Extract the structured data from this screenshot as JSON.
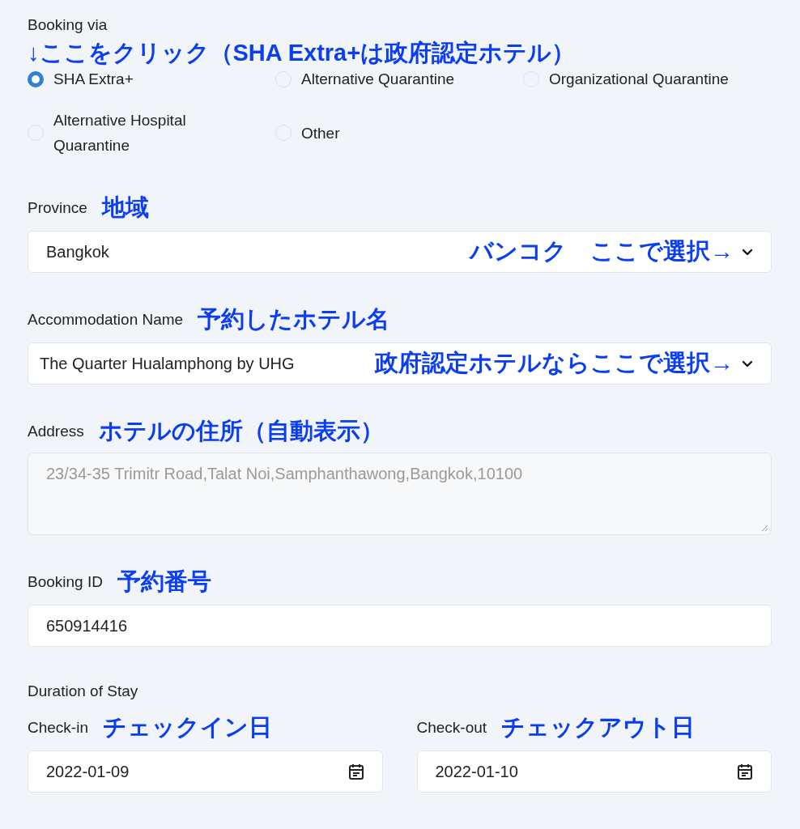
{
  "booking_via": {
    "label": "Booking via",
    "note": "↓ここをクリック（SHA Extra+は政府認定ホテル）",
    "options": [
      {
        "label": "SHA Extra+",
        "selected": true
      },
      {
        "label": "Alternative Quarantine",
        "selected": false
      },
      {
        "label": "Organizational Quarantine",
        "selected": false
      },
      {
        "label": "Alternative Hospital Quarantine",
        "selected": false
      },
      {
        "label": "Other",
        "selected": false
      }
    ]
  },
  "province": {
    "label": "Province",
    "note": "地域",
    "value": "Bangkok",
    "field_note": "バンコク　ここで選択→"
  },
  "accommodation": {
    "label": "Accommodation Name",
    "note": "予約したホテル名",
    "value": "The Quarter Hualamphong by UHG",
    "field_note": "政府認定ホテルならここで選択→"
  },
  "address": {
    "label": "Address",
    "note": "ホテルの住所（自動表示）",
    "value": "23/34-35 Trimitr Road,Talat Noi,Samphanthawong,Bangkok,10100",
    "disabled": true
  },
  "booking_id": {
    "label": "Booking ID",
    "note": "予約番号",
    "value": "650914416"
  },
  "duration": {
    "label": "Duration of Stay",
    "dates": [
      {
        "label": "Check-in",
        "note": "チェックイン日",
        "value": "2022-01-09"
      },
      {
        "label": "Check-out",
        "note": "チェックアウト日",
        "value": "2022-01-10"
      }
    ]
  }
}
